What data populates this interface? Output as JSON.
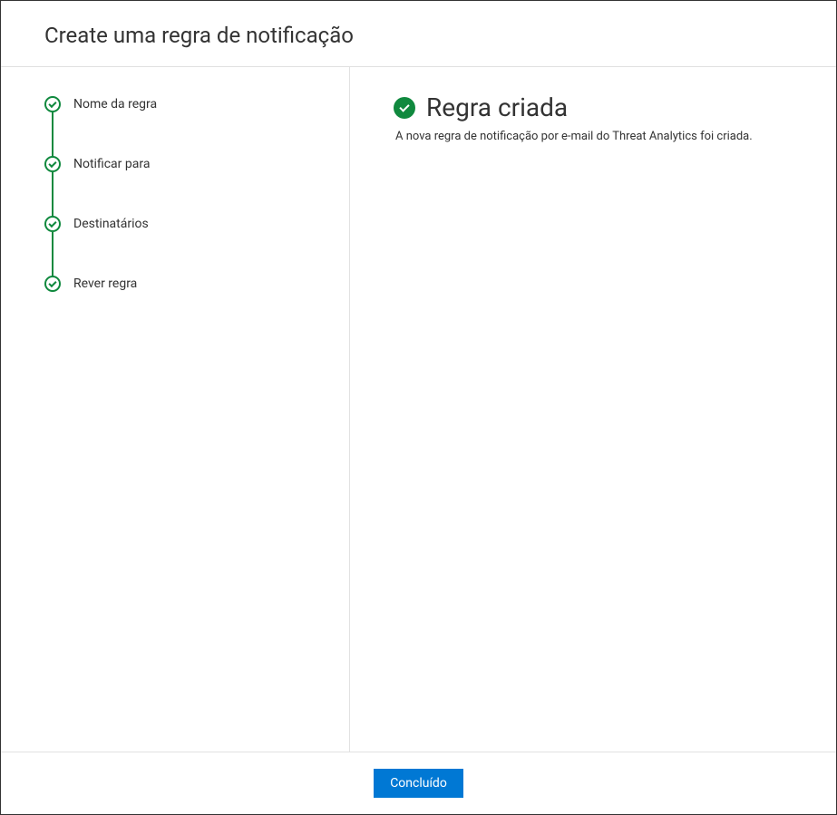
{
  "header": {
    "title": "Create uma regra de notificação"
  },
  "sidebar": {
    "steps": [
      {
        "label": "Nome da regra",
        "status": "completed"
      },
      {
        "label": "Notificar para",
        "status": "completed"
      },
      {
        "label": "Destinatários",
        "status": "completed"
      },
      {
        "label": "Rever regra",
        "status": "completed"
      }
    ]
  },
  "main": {
    "result_title": "Regra criada",
    "result_description": "A nova regra de notificação por e-mail do Threat Analytics foi criada."
  },
  "footer": {
    "done_label": "Concluído"
  },
  "colors": {
    "accent_primary": "#0078d4",
    "accent_success": "#10893e",
    "border": "#e1e1e1"
  }
}
